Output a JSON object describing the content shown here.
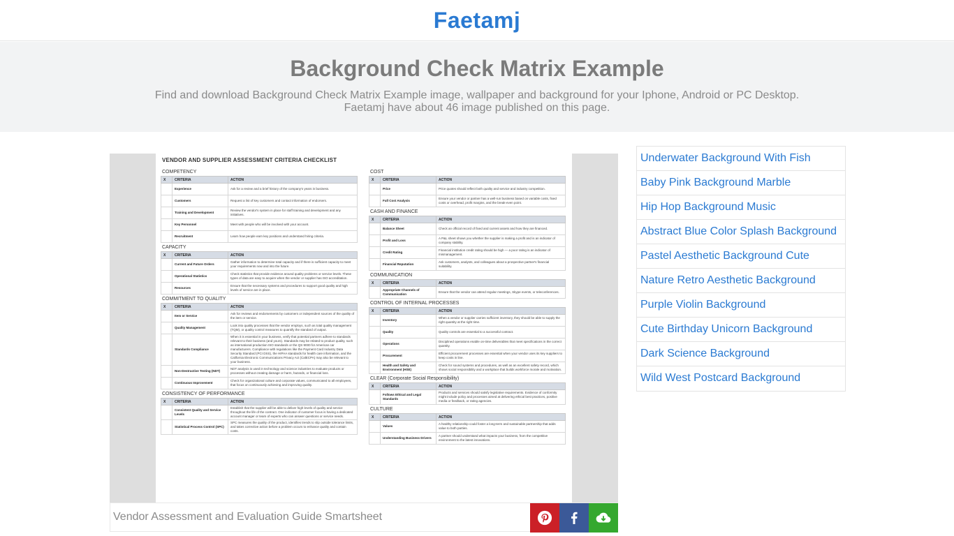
{
  "site": {
    "brand": "Faetamj"
  },
  "hero": {
    "title": "Background Check Matrix Example",
    "line1": "Find and download Background Check Matrix Example image, wallpaper and background for your Iphone, Android or PC Desktop.",
    "line2": "Faetamj have about 46 image published on this page."
  },
  "figure": {
    "caption": "Vendor Assessment and Evaluation Guide Smartsheet",
    "share": {
      "pinterest": "pinterest-icon",
      "facebook": "facebook-icon",
      "download": "download-icon"
    }
  },
  "document": {
    "title": "VENDOR AND SUPPLIER ASSESSMENT CRITERIA CHECKLIST",
    "headers": {
      "x": "X",
      "criteria": "CRITERIA",
      "action": "ACTION"
    },
    "left_sections": [
      {
        "name": "COMPETENCY",
        "rows": [
          {
            "criteria": "Experience",
            "action": "Ask for a review and a brief history of the company's years in business."
          },
          {
            "criteria": "Customers",
            "action": "Request a list of key customers and contact information of endorsers."
          },
          {
            "criteria": "Training and Development",
            "action": "Review the vendor's system in place for staff training and development and any initiatives."
          },
          {
            "criteria": "Key Personnel",
            "action": "Meet with people who will be involved with your account."
          },
          {
            "criteria": "Recruitment",
            "action": "Learn how people earn key positions and understand hiring criteria."
          }
        ]
      },
      {
        "name": "CAPACITY",
        "rows": [
          {
            "criteria": "Current and Future Orders",
            "action": "Gather information to determine total capacity and if there is sufficient capacity to meet your requirements now and into the future."
          },
          {
            "criteria": "Operational Statistics",
            "action": "Check statistics that provide evidence around quality problems or service levels. These types of data are easy to acquire when the vendor or supplier has ISO accreditation."
          },
          {
            "criteria": "Resources",
            "action": "Ensure that the necessary systems and procedures to support good quality and high levels of service are in place."
          }
        ]
      },
      {
        "name": "COMMITMENT TO QUALITY",
        "rows": [
          {
            "criteria": "Item or Service",
            "action": "Ask for reviews and endorsements by customers or independent sources of the quality of the item or service."
          },
          {
            "criteria": "Quality Management",
            "action": "Look into quality processes that the vendor employs, such as total quality management (TQM), or quality control measures to quantify the standard of output."
          },
          {
            "criteria": "Standards Compliance",
            "action": "When it is essential in your business, verify that potential partners adhere to standards relevant to their business (and yours). Standards may be related to product quality, such as international production ISO standards or the QS 9000 for American car manufacturers. Compliance with regulations like the Payment Card Industry Data Security Standard (PCI DSS), the HIPAA standards for health care information, and the California Electronic Communications Privacy Act (CalECPA) may also be relevant to your business."
          },
          {
            "criteria": "Non-Destructive Testing (NDT)",
            "action": "NDT analysis is used in technology and science industries to evaluate products or processes without creating damage or harm, hazards, or financial loss."
          },
          {
            "criteria": "Continuous Improvement",
            "action": "Check for organizational culture and corporate values, communicated to all employees, that focus on continuously achieving and improving quality."
          }
        ]
      },
      {
        "name": "CONSISTENCY OF PERFORMANCE",
        "rows": [
          {
            "criteria": "Consistent Quality and Service Levels",
            "action": "Establish that the supplier will be able to deliver high levels of quality and service throughout the life of the contract. One indicator of customer focus is having a dedicated account manager or team of experts who can answer questions or service needs."
          },
          {
            "criteria": "Statistical Process Control (SPC)",
            "action": "SPC measures the quality of the product, identifies trends to slip outside tolerance limits, and takes corrective action before a problem occurs to enhance quality and contain costs."
          }
        ]
      }
    ],
    "right_sections": [
      {
        "name": "COST",
        "rows": [
          {
            "criteria": "Price",
            "action": "Price quotes should reflect both quality and service and industry competition."
          },
          {
            "criteria": "Full Cost Analysis",
            "action": "Ensure your vendor or partner has a well-run business based on variable costs, fixed costs or overhead, profit margins, and the break-even point."
          }
        ]
      },
      {
        "name": "CASH AND FINANCE",
        "rows": [
          {
            "criteria": "Balance Sheet",
            "action": "Check an official record of fixed and current assets and how they are financed."
          },
          {
            "criteria": "Profit and Loss",
            "action": "A P&L sheet shows you whether the supplier is making a profit and is an indicator of company stability."
          },
          {
            "criteria": "Credit Rating",
            "action": "Financial institution credit rating should be high — a poor rating is an indicator of mismanagement."
          },
          {
            "criteria": "Financial Reputation",
            "action": "Ask customers, analysts, and colleagues about a prospective partner's financial suitability."
          }
        ]
      },
      {
        "name": "COMMUNICATION",
        "rows": [
          {
            "criteria": "Appropriate Channels of Communication",
            "action": "Ensure that the vendor can attend regular meetings, Skype events, or teleconferences."
          }
        ]
      },
      {
        "name": "CONTROL OF INTERNAL PROCESSES",
        "rows": [
          {
            "criteria": "Inventory",
            "action": "When a vendor or supplier carries sufficient inventory, they should be able to supply the right quantity at the right time."
          },
          {
            "criteria": "Quality",
            "action": "Quality controls are essential to a successful contract."
          },
          {
            "criteria": "Operations",
            "action": "Disciplined operations enable on-time deliverables that meet specifications in the correct quantity."
          },
          {
            "criteria": "Procurement",
            "action": "Efficient procurement processes are essential when your vendor uses its key suppliers to keep costs in line."
          },
          {
            "criteria": "Health and Safety and Environment (HSE)",
            "action": "Check for sound systems and procedures, as well as an excellent safety record, which shows social responsibility and a workplace that builds workforce morale and motivation."
          }
        ]
      },
      {
        "name": "CLEAR (Corporate Social Responsibility)",
        "rows": [
          {
            "criteria": "Follows Ethical and Legal Standards",
            "action": "Products and services should satisfy legislative requirements. Evidence of conformity might include policy and processes aimed at delivering ethical best practices, positive media or feedback, or rating agencies."
          }
        ]
      },
      {
        "name": "CULTURE",
        "rows": [
          {
            "criteria": "Values",
            "action": "A healthy relationship could foster a long-term and sustainable partnership that adds value to both parties."
          },
          {
            "criteria": "Understanding Business Drivers",
            "action": "A partner should understand what impacts your business, from the competitive environment to the latest innovations."
          }
        ]
      }
    ]
  },
  "sidebar": {
    "links": [
      "Underwater Background With Fish",
      "Baby Pink Background Marble",
      "Hip Hop Background Music",
      "Abstract Blue Color Splash Background",
      "Pastel Aesthetic Background Cute",
      "Nature Retro Aesthetic Background",
      "Purple Violin Background",
      "Cute Birthday Unicorn Background",
      "Dark Science Background",
      "Wild West Postcard Background"
    ]
  }
}
